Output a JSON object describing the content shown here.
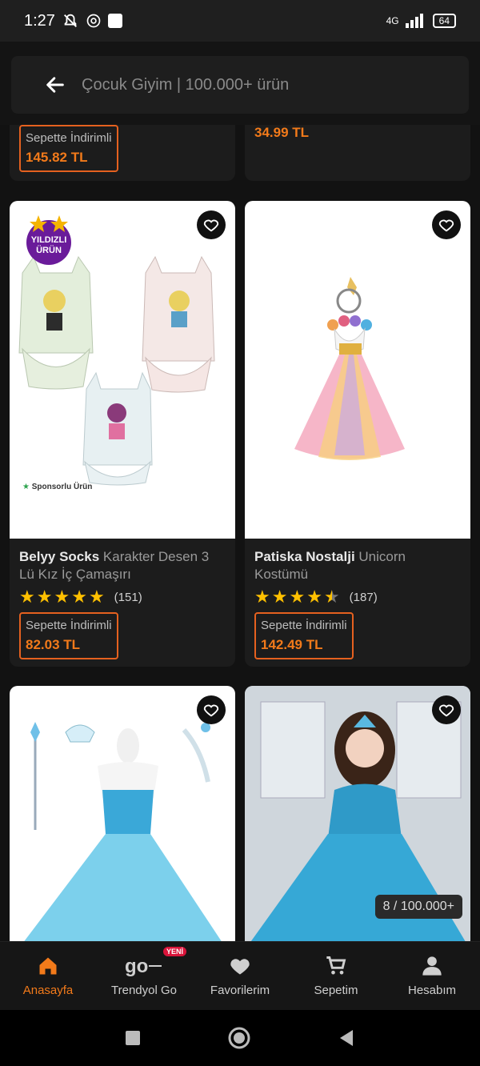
{
  "status": {
    "time": "1:27",
    "battery": "64",
    "network": "4G"
  },
  "header": {
    "title": "Çocuk Giyim | 100.000+ ürün"
  },
  "prev_row": {
    "left_price_label": "Sepette İndirimli",
    "left_price": "145.82 TL",
    "right_price": "34.99 TL"
  },
  "products": [
    {
      "brand": "Belyy Socks",
      "name": "Karakter Desen 3 Lü Kız İç Çamaşırı",
      "rating": 5,
      "reviews": "(151)",
      "price_label": "Sepette İndirimli",
      "price": "82.03 TL",
      "badge": "YILDIZLI ÜRÜN",
      "sponsored": "Sponsorlu Ürün"
    },
    {
      "brand": "Patiska Nostalji",
      "name": "Unicorn Kostümü",
      "rating": 4.5,
      "reviews": "(187)",
      "price_label": "Sepette İndirimli",
      "price": "142.49 TL"
    }
  ],
  "counter": "8 / 100.000+",
  "nav": [
    {
      "label": "Anasayfa",
      "icon": "home-icon"
    },
    {
      "label": "Trendyol Go",
      "icon": "go-icon",
      "badge": "YENİ"
    },
    {
      "label": "Favorilerim",
      "icon": "heart-icon"
    },
    {
      "label": "Sepetim",
      "icon": "cart-icon"
    },
    {
      "label": "Hesabım",
      "icon": "user-icon"
    }
  ],
  "colors": {
    "accent": "#f27a1a",
    "background": "#121212",
    "card": "#1c1c1c"
  }
}
